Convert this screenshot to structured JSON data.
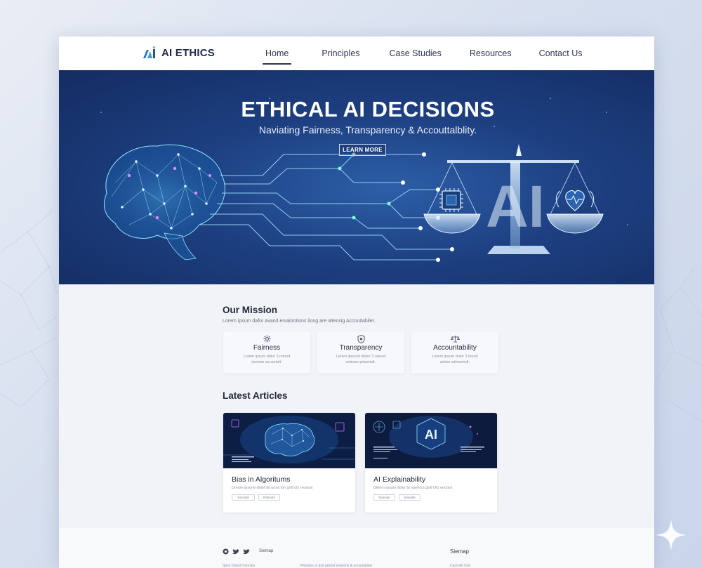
{
  "brand": {
    "name": "AI ETHICS",
    "logo_icon": "ai-logo-icon",
    "accent": "#2b74c8"
  },
  "nav": {
    "items": [
      {
        "label": "Home",
        "active": true
      },
      {
        "label": "Principles"
      },
      {
        "label": "Case Studies"
      },
      {
        "label": "Resources"
      },
      {
        "label": "Contact Us"
      }
    ]
  },
  "hero": {
    "title": "ETHICAL AI DECISIONS",
    "subtitle": "Naviating Fairness, Transparency & Accouttalblity.",
    "button": "LEARN MORE",
    "scale_label": "AI",
    "colors": {
      "bg_dark": "#142c62",
      "bg_light": "#2d5fa8",
      "circuit": "#a7e8ff"
    }
  },
  "mission": {
    "title": "Our Mission",
    "description": "Lorem ipsum dafor avand ervaitrotions liong are alteosig Accoutiabilet.",
    "cards": [
      {
        "icon": "gear-icon",
        "title": "Fairness",
        "desc_line1": "Lorem ipsum dolor 3 nonod",
        "desc_line2": "doniom sa sortolt."
      },
      {
        "icon": "shield-icon",
        "title": "Transparency",
        "desc_line1": "Lenen ipscunt dlolor 3 nanod",
        "desc_line2": "exinore prisortolt."
      },
      {
        "icon": "balance-icon",
        "title": "Accountability",
        "desc_line1": "Lorem ipsum dulor 3 inood",
        "desc_line2": "aetise wiirwortolt."
      }
    ]
  },
  "articles": {
    "title": "Latest Articles",
    "items": [
      {
        "title": "Bias in Algoritums",
        "desc": "Dreum ipsurw didol do unsd lon grdl i2s moxtos",
        "tags": [
          "Sacrank",
          "Rabnotir"
        ],
        "image_icon": "brain-icon"
      },
      {
        "title": "AI Explainability",
        "desc": "Dlenm ipsum dolor bi nuencrs grdl Ut1 enctios",
        "tags": [
          "Sianoan",
          "Sianabe"
        ],
        "image_icon": "ai-chip-icon"
      }
    ]
  },
  "footer": {
    "social_icons": [
      "github-icon",
      "twitter-icon",
      "twitter-icon"
    ],
    "left_label": "Siemap",
    "right_label": "Siemap",
    "row": [
      "Spsn Ospol hrsonios",
      "Plesvies ot tpst (about eresions & ecountaitive",
      "Caorolin Uon"
    ]
  }
}
